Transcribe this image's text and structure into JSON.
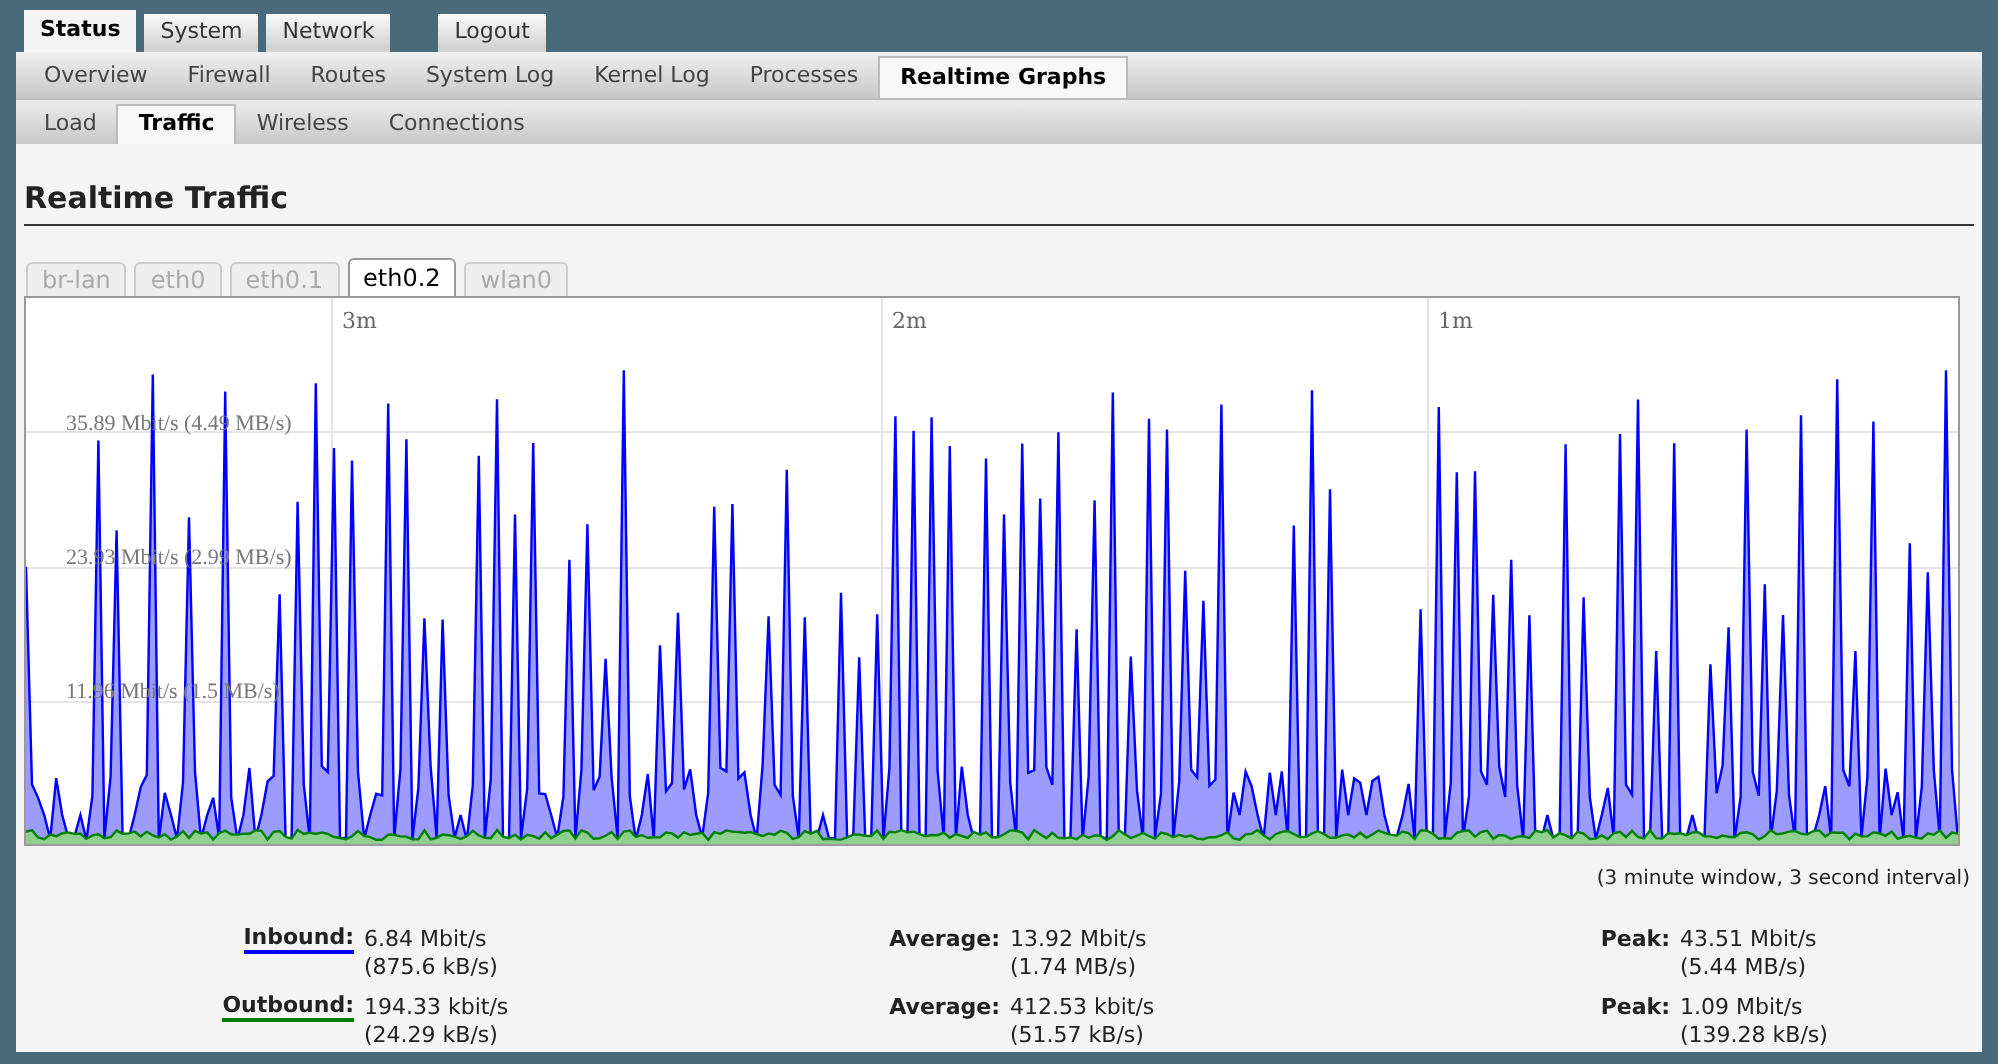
{
  "top_tabs": [
    {
      "label": "Status",
      "selected": true
    },
    {
      "label": "System",
      "selected": false
    },
    {
      "label": "Network",
      "selected": false
    }
  ],
  "logout": "Logout",
  "menu": [
    {
      "label": "Overview",
      "selected": false
    },
    {
      "label": "Firewall",
      "selected": false
    },
    {
      "label": "Routes",
      "selected": false
    },
    {
      "label": "System Log",
      "selected": false
    },
    {
      "label": "Kernel Log",
      "selected": false
    },
    {
      "label": "Processes",
      "selected": false
    },
    {
      "label": "Realtime Graphs",
      "selected": true
    }
  ],
  "submenu": [
    {
      "label": "Load",
      "selected": false
    },
    {
      "label": "Traffic",
      "selected": true
    },
    {
      "label": "Wireless",
      "selected": false
    },
    {
      "label": "Connections",
      "selected": false
    }
  ],
  "title": "Realtime Traffic",
  "interfaces": [
    {
      "label": "br-lan",
      "selected": false
    },
    {
      "label": "eth0",
      "selected": false
    },
    {
      "label": "eth0.1",
      "selected": false
    },
    {
      "label": "eth0.2",
      "selected": true
    },
    {
      "label": "wlan0",
      "selected": false
    }
  ],
  "graph": {
    "x_labels": [
      "3m",
      "2m",
      "1m"
    ],
    "y_labels": [
      "35.89 Mbit/s (4.49 MB/s)",
      "23.93 Mbit/s (2.99 MB/s)",
      "11.96 Mbit/s (1.5 MB/s)"
    ]
  },
  "caption": "(3 minute window, 3 second interval)",
  "stats": [
    {
      "label": "Inbound:",
      "color": "#0000ff",
      "current": [
        "6.84 Mbit/s",
        "(875.6 kB/s)"
      ],
      "average_label": "Average:",
      "average": [
        "13.92 Mbit/s",
        "(1.74 MB/s)"
      ],
      "peak_label": "Peak:",
      "peak": [
        "43.51 Mbit/s",
        "(5.44 MB/s)"
      ]
    },
    {
      "label": "Outbound:",
      "color": "#008000",
      "current": [
        "194.33 kbit/s",
        "(24.29 kB/s)"
      ],
      "average_label": "Average:",
      "average": [
        "412.53 kbit/s",
        "(51.57 kB/s)"
      ],
      "peak_label": "Peak:",
      "peak": [
        "1.09 Mbit/s",
        "(139.28 kB/s)"
      ]
    }
  ]
}
